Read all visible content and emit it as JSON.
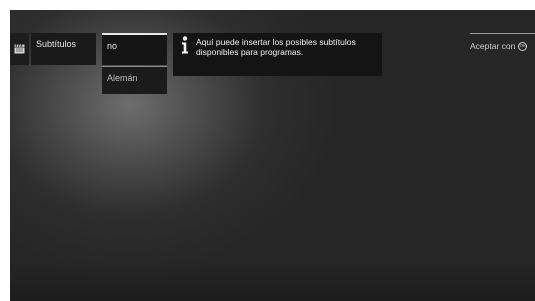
{
  "menu": {
    "category_icon": "clapperboard-icon",
    "category_label": "Subtítulos",
    "options": [
      {
        "label": "no",
        "selected": true
      },
      {
        "label": "Alemán",
        "selected": false
      }
    ]
  },
  "info": {
    "icon": "info-icon",
    "line1": "Aquí puede insertar los posibles subtítulos",
    "line2": "disponibles para programas."
  },
  "accept": {
    "label": "Aceptar con",
    "button_label": "OK",
    "button_icon": "ok-button-icon"
  },
  "colors": {
    "background": "#262626",
    "panel": "#1a1a1a",
    "text": "#e6e6e6",
    "selection_line": "#e9e9e9"
  }
}
